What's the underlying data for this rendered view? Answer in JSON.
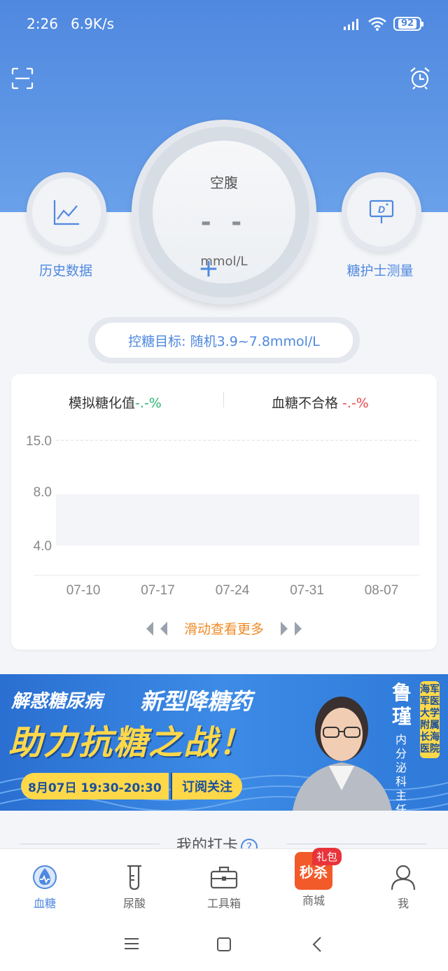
{
  "status_bar": {
    "time": "2:26",
    "net_speed": "6.9K/s",
    "battery": "92"
  },
  "colors": {
    "primary": "#4f88df",
    "accent_orange": "#f08a24",
    "green": "#2bb673",
    "red": "#e8484e"
  },
  "header": {
    "scan_icon": "scan-icon",
    "alarm_icon": "alarm-clock-icon"
  },
  "measure": {
    "label": "空腹",
    "value": "- -",
    "unit": "mmol/L",
    "add": "+"
  },
  "left_shortcut": {
    "label": "历史数据",
    "icon": "line-chart-icon"
  },
  "right_shortcut": {
    "label": "糖护士测量",
    "icon": "device-icon"
  },
  "target": {
    "text": "控糖目标: 随机3.9~7.8mmol/L"
  },
  "stats": {
    "hba1c_label": "模拟糖化值",
    "hba1c_value": "-.-%",
    "fail_label": "血糖不合格 ",
    "fail_value": "-.-%"
  },
  "chart_data": {
    "type": "scatter",
    "x_ticks": [
      "07-10",
      "07-17",
      "07-24",
      "07-31",
      "08-07"
    ],
    "y_ticks": [
      "15.0",
      "8.0",
      "4.0"
    ],
    "target_band": [
      4.0,
      8.0
    ],
    "series": []
  },
  "chart": {
    "slide_text": "滑动查看更多"
  },
  "banner": {
    "line1": "解惑糖尿病",
    "line1b": "新型降糖药",
    "line2": "助力抗糖之战！",
    "date": "8月07日 19:30-20:30",
    "subscribe": "订阅关注",
    "name": "鲁瑾",
    "title": "内分泌科主任",
    "hospital": "海军军医大学附属长海医院"
  },
  "checkin": {
    "title": "我的打卡",
    "help": "?"
  },
  "tabbar": {
    "items": [
      {
        "label": "血糖",
        "icon": "blood-drop-icon"
      },
      {
        "label": "尿酸",
        "icon": "test-tube-icon"
      },
      {
        "label": "工具箱",
        "icon": "toolbox-icon"
      },
      {
        "label": "商城",
        "icon": "flash-sale-icon",
        "badge": "秒杀",
        "gift": "礼包"
      },
      {
        "label": "我",
        "icon": "user-icon"
      }
    ]
  }
}
